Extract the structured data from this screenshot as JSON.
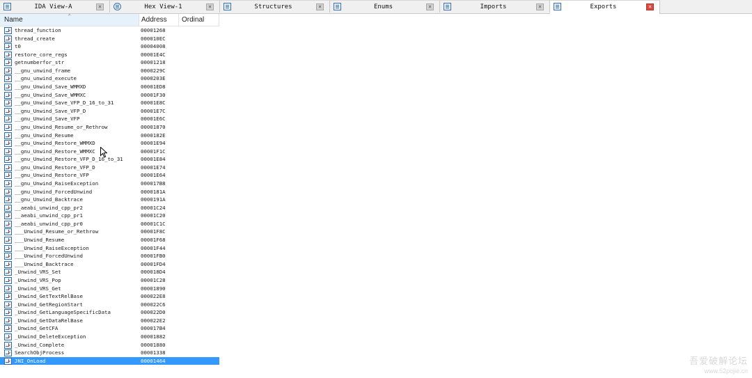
{
  "tabs": [
    {
      "label": "IDA View-A",
      "icon": "disassembly-view-icon",
      "active": false
    },
    {
      "label": "Hex View-1",
      "icon": "hex-view-icon",
      "active": false
    },
    {
      "label": "Structures",
      "icon": "structures-icon",
      "active": false
    },
    {
      "label": "Enums",
      "icon": "enums-icon",
      "active": false
    },
    {
      "label": "Imports",
      "icon": "imports-icon",
      "active": false
    },
    {
      "label": "Exports",
      "icon": "exports-icon",
      "active": true
    }
  ],
  "tab_close_glyph": "×",
  "columns": {
    "name": "Name",
    "address": "Address",
    "ordinal": "Ordinal"
  },
  "sort_indicator": "^",
  "rows": [
    {
      "name": "thread_function",
      "address": "00001268",
      "ordinal": ""
    },
    {
      "name": "thread_create",
      "address": "000010EC",
      "ordinal": ""
    },
    {
      "name": "t0",
      "address": "00004008",
      "ordinal": ""
    },
    {
      "name": "restore_core_regs",
      "address": "00001E4C",
      "ordinal": ""
    },
    {
      "name": "getnumberfor_str",
      "address": "00001218",
      "ordinal": ""
    },
    {
      "name": "__gnu_unwind_frame",
      "address": "0000229C",
      "ordinal": ""
    },
    {
      "name": "__gnu_unwind_execute",
      "address": "0000203E",
      "ordinal": ""
    },
    {
      "name": "__gnu_Unwind_Save_WMMXD",
      "address": "00001ED8",
      "ordinal": ""
    },
    {
      "name": "__gnu_Unwind_Save_WMMXC",
      "address": "00001F30",
      "ordinal": ""
    },
    {
      "name": "__gnu_Unwind_Save_VFP_D_16_to_31",
      "address": "00001E8C",
      "ordinal": ""
    },
    {
      "name": "__gnu_Unwind_Save_VFP_D",
      "address": "00001E7C",
      "ordinal": ""
    },
    {
      "name": "__gnu_Unwind_Save_VFP",
      "address": "00001E6C",
      "ordinal": ""
    },
    {
      "name": "__gnu_Unwind_Resume_or_Rethrow",
      "address": "00001870",
      "ordinal": ""
    },
    {
      "name": "__gnu_Unwind_Resume",
      "address": "0000182E",
      "ordinal": ""
    },
    {
      "name": "__gnu_Unwind_Restore_WMMXD",
      "address": "00001E94",
      "ordinal": ""
    },
    {
      "name": "__gnu_Unwind_Restore_WMMXC",
      "address": "00001F1C",
      "ordinal": ""
    },
    {
      "name": "__gnu_Unwind_Restore_VFP_D_16_to_31",
      "address": "00001E84",
      "ordinal": ""
    },
    {
      "name": "__gnu_Unwind_Restore_VFP_D",
      "address": "00001E74",
      "ordinal": ""
    },
    {
      "name": "__gnu_Unwind_Restore_VFP",
      "address": "00001E64",
      "ordinal": ""
    },
    {
      "name": "__gnu_Unwind_RaiseException",
      "address": "000017B8",
      "ordinal": ""
    },
    {
      "name": "__gnu_Unwind_ForcedUnwind",
      "address": "0000181A",
      "ordinal": ""
    },
    {
      "name": "__gnu_Unwind_Backtrace",
      "address": "0000191A",
      "ordinal": ""
    },
    {
      "name": "__aeabi_unwind_cpp_pr2",
      "address": "00001C24",
      "ordinal": ""
    },
    {
      "name": "__aeabi_unwind_cpp_pr1",
      "address": "00001C20",
      "ordinal": ""
    },
    {
      "name": "__aeabi_unwind_cpp_pr0",
      "address": "00001C1C",
      "ordinal": ""
    },
    {
      "name": "___Unwind_Resume_or_Rethrow",
      "address": "00001F8C",
      "ordinal": ""
    },
    {
      "name": "___Unwind_Resume",
      "address": "00001F68",
      "ordinal": ""
    },
    {
      "name": "___Unwind_RaiseException",
      "address": "00001F44",
      "ordinal": ""
    },
    {
      "name": "___Unwind_ForcedUnwind",
      "address": "00001FB0",
      "ordinal": ""
    },
    {
      "name": "___Unwind_Backtrace",
      "address": "00001FD4",
      "ordinal": ""
    },
    {
      "name": "_Unwind_VRS_Set",
      "address": "000018D4",
      "ordinal": ""
    },
    {
      "name": "_Unwind_VRS_Pop",
      "address": "00001C28",
      "ordinal": ""
    },
    {
      "name": "_Unwind_VRS_Get",
      "address": "00001890",
      "ordinal": ""
    },
    {
      "name": "_Unwind_GetTextRelBase",
      "address": "000022E8",
      "ordinal": ""
    },
    {
      "name": "_Unwind_GetRegionStart",
      "address": "000022C6",
      "ordinal": ""
    },
    {
      "name": "_Unwind_GetLanguageSpecificData",
      "address": "000022D0",
      "ordinal": ""
    },
    {
      "name": "_Unwind_GetDataRelBase",
      "address": "000022E2",
      "ordinal": ""
    },
    {
      "name": "_Unwind_GetCFA",
      "address": "000017B4",
      "ordinal": ""
    },
    {
      "name": "_Unwind_DeleteException",
      "address": "00001882",
      "ordinal": ""
    },
    {
      "name": "_Unwind_Complete",
      "address": "00001880",
      "ordinal": ""
    },
    {
      "name": "SearchObjProcess",
      "address": "00001338",
      "ordinal": ""
    },
    {
      "name": "JNI_OnLoad",
      "address": "00001464",
      "ordinal": "",
      "selected": true
    }
  ],
  "colors": {
    "selection": "#3399ff",
    "name_header_bg": "#e5f1fb",
    "active_close": "#e0483c"
  },
  "watermark": {
    "line1": "吾爱破解论坛",
    "line2": "www.52pojie.cn"
  }
}
